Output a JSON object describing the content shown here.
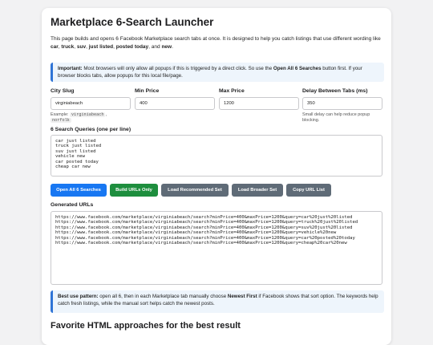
{
  "title": "Marketplace 6-Search Launcher",
  "intro": {
    "p1": "This page builds and opens 6 Facebook Marketplace search tabs at once. It is designed to help you catch listings that use different wording like ",
    "k1": "car",
    "s1": ", ",
    "k2": "truck",
    "s2": ", ",
    "k3": "suv",
    "s3": ", ",
    "k4": "just listed",
    "s4": ", ",
    "k5": "posted today",
    "s5": ", and ",
    "k6": "new",
    "s6": "."
  },
  "notice": {
    "label": "Important:",
    "t1": " Most browsers will only allow all popups if this is triggered by a direct click. So use the ",
    "button_ref": "Open All 6 Searches",
    "t2": " button first. If your browser blocks tabs, allow popups for this local file/page."
  },
  "fields": {
    "city": {
      "label": "City Slug",
      "value": "virginiabeach",
      "hint_prefix": "Example: ",
      "hint_code1": "virginiabeach",
      "hint_sep": ",",
      "hint_code2": "norfolk"
    },
    "min_price": {
      "label": "Min Price",
      "value": "400"
    },
    "max_price": {
      "label": "Max Price",
      "value": "1200"
    },
    "delay": {
      "label": "Delay Between Tabs (ms)",
      "value": "350",
      "hint": "Small delay can help reduce popup blocking."
    }
  },
  "queries": {
    "label": "6 Search Queries (one per line)",
    "value": "car just listed\ntruck just listed\nsuv just listed\nvehicle new\ncar posted today\ncheap car new"
  },
  "buttons": {
    "open_all": "Open All 6 Searches",
    "build_urls": "Build URLs Only",
    "load_recommended": "Load Recommended Set",
    "load_broader": "Load Broader Set",
    "copy_url": "Copy URL List"
  },
  "generated": {
    "label": "Generated URLs",
    "value": "https://www.facebook.com/marketplace/virginiabeach/search?minPrice=400&maxPrice=1200&query=car%20just%20listed\nhttps://www.facebook.com/marketplace/virginiabeach/search?minPrice=400&maxPrice=1200&query=truck%20just%20listed\nhttps://www.facebook.com/marketplace/virginiabeach/search?minPrice=400&maxPrice=1200&query=suv%20just%20listed\nhttps://www.facebook.com/marketplace/virginiabeach/search?minPrice=400&maxPrice=1200&query=vehicle%20new\nhttps://www.facebook.com/marketplace/virginiabeach/search?minPrice=400&maxPrice=1200&query=car%20posted%20today\nhttps://www.facebook.com/marketplace/virginiabeach/search?minPrice=400&maxPrice=1200&query=cheap%20car%20new"
  },
  "best_use": {
    "label": "Best use pattern:",
    "t1": " open all 6, then in each Marketplace tab manually choose ",
    "newest": "Newest First",
    "t2": " if Facebook shows that sort option. The keywords help catch fresh listings, while the manual sort helps catch the newest posts."
  },
  "section2_title": "Favorite HTML approaches for the best result",
  "colors": {
    "primary": "#1877f2",
    "success": "#1e8e3e",
    "secondary": "#5f6b77",
    "info_bg": "#eef5fc",
    "info_border": "#2f74d6"
  }
}
